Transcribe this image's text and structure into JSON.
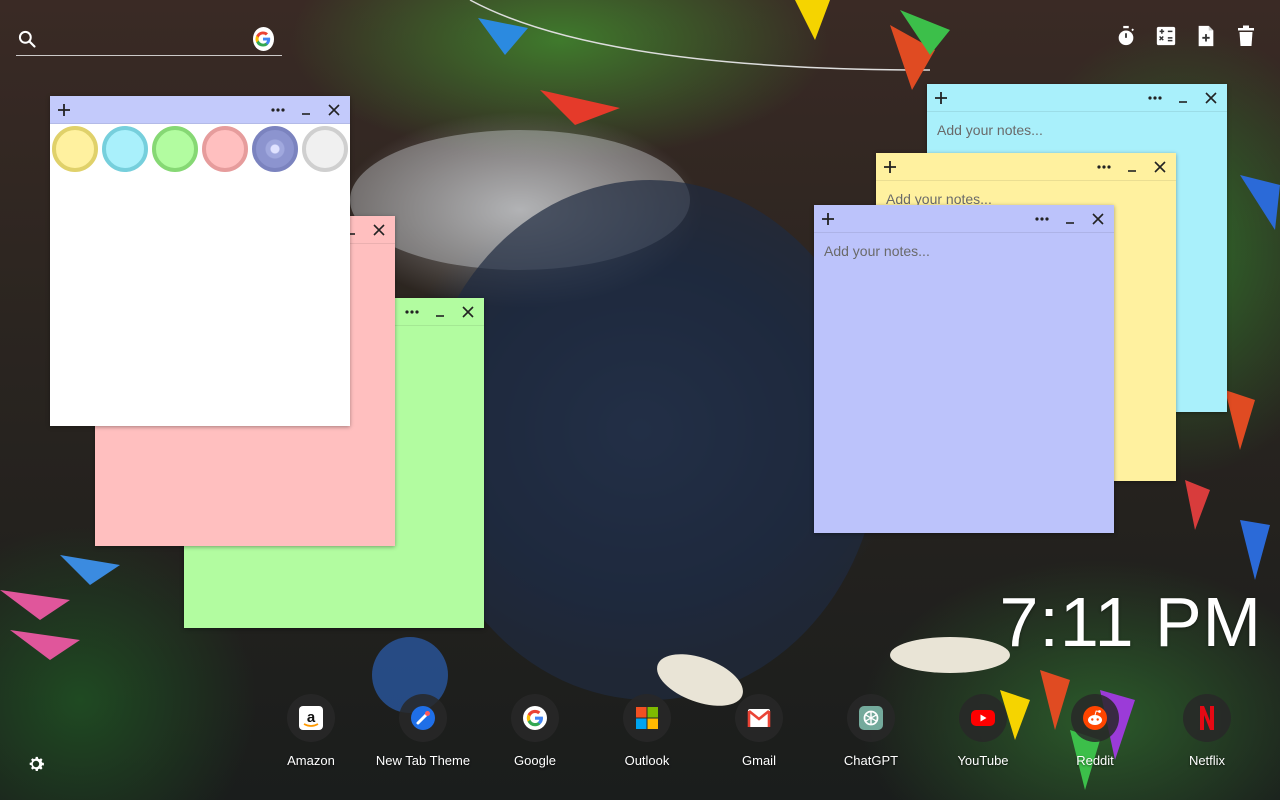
{
  "search": {
    "value": "",
    "placeholder": ""
  },
  "toolbar": {
    "icons": [
      "timer-icon",
      "calculator-icon",
      "new-note-icon",
      "trash-icon"
    ]
  },
  "notes": [
    {
      "color": "#ffffff",
      "placeholder": "",
      "type": "color-picker"
    },
    {
      "color": "#ffbfbf",
      "placeholder": ""
    },
    {
      "color": "#b2fca0",
      "placeholder": ""
    },
    {
      "color": "#a9f0fb",
      "placeholder": "Add your notes..."
    },
    {
      "color": "#fff19f",
      "placeholder": "Add your notes..."
    },
    {
      "color": "#bcc3fb",
      "placeholder": "Add your notes..."
    }
  ],
  "palette": [
    {
      "name": "yellow",
      "fill": "#fff19f",
      "ring": "#e0d16a"
    },
    {
      "name": "blue",
      "fill": "#a9f0fb",
      "ring": "#76cfdc"
    },
    {
      "name": "green",
      "fill": "#b2fca0",
      "ring": "#86d874"
    },
    {
      "name": "pink",
      "fill": "#ffbfbf",
      "ring": "#e69c9c"
    },
    {
      "name": "purple",
      "fill": "#bcc3fb",
      "ring": "#8d95cf"
    },
    {
      "name": "gray",
      "fill": "#f0f0f0",
      "ring": "#cfcfcf"
    }
  ],
  "clock": {
    "time": "7:11 PM"
  },
  "shortcuts": [
    {
      "label": "Amazon",
      "icon": "amazon-icon"
    },
    {
      "label": "New Tab Theme",
      "icon": "new-tab-theme-icon"
    },
    {
      "label": "Google",
      "icon": "google-icon"
    },
    {
      "label": "Outlook",
      "icon": "outlook-icon"
    },
    {
      "label": "Gmail",
      "icon": "gmail-icon"
    },
    {
      "label": "ChatGPT",
      "icon": "chatgpt-icon"
    },
    {
      "label": "YouTube",
      "icon": "youtube-icon"
    },
    {
      "label": "Reddit",
      "icon": "reddit-icon"
    },
    {
      "label": "Netflix",
      "icon": "netflix-icon"
    }
  ]
}
